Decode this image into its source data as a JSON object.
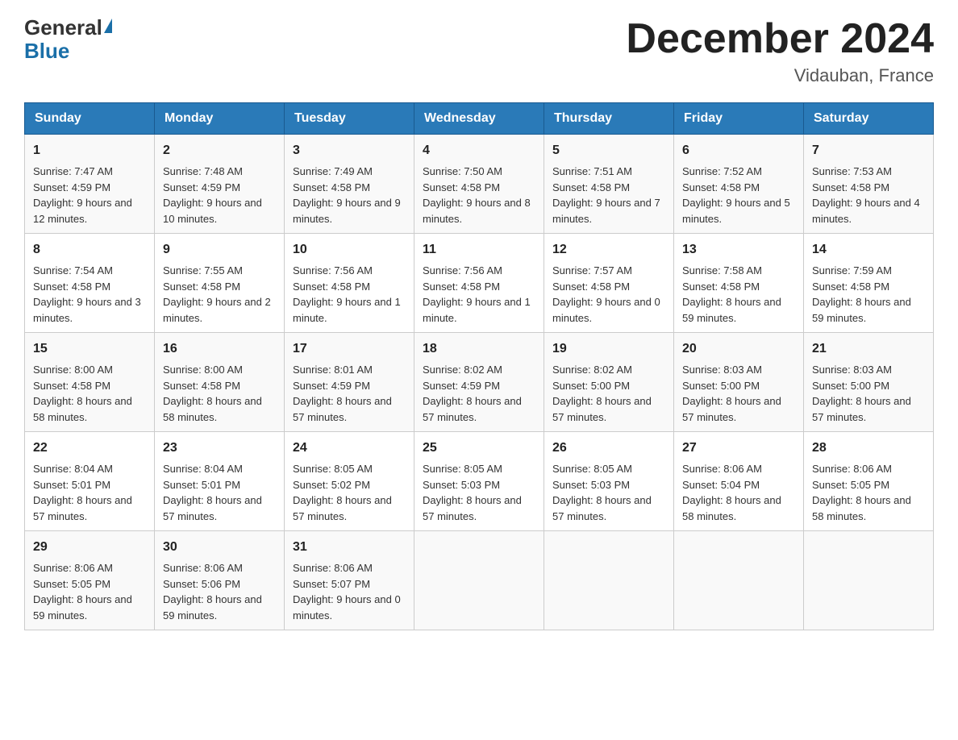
{
  "logo": {
    "general": "General",
    "blue": "Blue"
  },
  "title": "December 2024",
  "subtitle": "Vidauban, France",
  "days_header": [
    "Sunday",
    "Monday",
    "Tuesday",
    "Wednesday",
    "Thursday",
    "Friday",
    "Saturday"
  ],
  "weeks": [
    [
      {
        "day": "1",
        "sunrise": "7:47 AM",
        "sunset": "4:59 PM",
        "daylight": "9 hours and 12 minutes."
      },
      {
        "day": "2",
        "sunrise": "7:48 AM",
        "sunset": "4:59 PM",
        "daylight": "9 hours and 10 minutes."
      },
      {
        "day": "3",
        "sunrise": "7:49 AM",
        "sunset": "4:58 PM",
        "daylight": "9 hours and 9 minutes."
      },
      {
        "day": "4",
        "sunrise": "7:50 AM",
        "sunset": "4:58 PM",
        "daylight": "9 hours and 8 minutes."
      },
      {
        "day": "5",
        "sunrise": "7:51 AM",
        "sunset": "4:58 PM",
        "daylight": "9 hours and 7 minutes."
      },
      {
        "day": "6",
        "sunrise": "7:52 AM",
        "sunset": "4:58 PM",
        "daylight": "9 hours and 5 minutes."
      },
      {
        "day": "7",
        "sunrise": "7:53 AM",
        "sunset": "4:58 PM",
        "daylight": "9 hours and 4 minutes."
      }
    ],
    [
      {
        "day": "8",
        "sunrise": "7:54 AM",
        "sunset": "4:58 PM",
        "daylight": "9 hours and 3 minutes."
      },
      {
        "day": "9",
        "sunrise": "7:55 AM",
        "sunset": "4:58 PM",
        "daylight": "9 hours and 2 minutes."
      },
      {
        "day": "10",
        "sunrise": "7:56 AM",
        "sunset": "4:58 PM",
        "daylight": "9 hours and 1 minute."
      },
      {
        "day": "11",
        "sunrise": "7:56 AM",
        "sunset": "4:58 PM",
        "daylight": "9 hours and 1 minute."
      },
      {
        "day": "12",
        "sunrise": "7:57 AM",
        "sunset": "4:58 PM",
        "daylight": "9 hours and 0 minutes."
      },
      {
        "day": "13",
        "sunrise": "7:58 AM",
        "sunset": "4:58 PM",
        "daylight": "8 hours and 59 minutes."
      },
      {
        "day": "14",
        "sunrise": "7:59 AM",
        "sunset": "4:58 PM",
        "daylight": "8 hours and 59 minutes."
      }
    ],
    [
      {
        "day": "15",
        "sunrise": "8:00 AM",
        "sunset": "4:58 PM",
        "daylight": "8 hours and 58 minutes."
      },
      {
        "day": "16",
        "sunrise": "8:00 AM",
        "sunset": "4:58 PM",
        "daylight": "8 hours and 58 minutes."
      },
      {
        "day": "17",
        "sunrise": "8:01 AM",
        "sunset": "4:59 PM",
        "daylight": "8 hours and 57 minutes."
      },
      {
        "day": "18",
        "sunrise": "8:02 AM",
        "sunset": "4:59 PM",
        "daylight": "8 hours and 57 minutes."
      },
      {
        "day": "19",
        "sunrise": "8:02 AM",
        "sunset": "5:00 PM",
        "daylight": "8 hours and 57 minutes."
      },
      {
        "day": "20",
        "sunrise": "8:03 AM",
        "sunset": "5:00 PM",
        "daylight": "8 hours and 57 minutes."
      },
      {
        "day": "21",
        "sunrise": "8:03 AM",
        "sunset": "5:00 PM",
        "daylight": "8 hours and 57 minutes."
      }
    ],
    [
      {
        "day": "22",
        "sunrise": "8:04 AM",
        "sunset": "5:01 PM",
        "daylight": "8 hours and 57 minutes."
      },
      {
        "day": "23",
        "sunrise": "8:04 AM",
        "sunset": "5:01 PM",
        "daylight": "8 hours and 57 minutes."
      },
      {
        "day": "24",
        "sunrise": "8:05 AM",
        "sunset": "5:02 PM",
        "daylight": "8 hours and 57 minutes."
      },
      {
        "day": "25",
        "sunrise": "8:05 AM",
        "sunset": "5:03 PM",
        "daylight": "8 hours and 57 minutes."
      },
      {
        "day": "26",
        "sunrise": "8:05 AM",
        "sunset": "5:03 PM",
        "daylight": "8 hours and 57 minutes."
      },
      {
        "day": "27",
        "sunrise": "8:06 AM",
        "sunset": "5:04 PM",
        "daylight": "8 hours and 58 minutes."
      },
      {
        "day": "28",
        "sunrise": "8:06 AM",
        "sunset": "5:05 PM",
        "daylight": "8 hours and 58 minutes."
      }
    ],
    [
      {
        "day": "29",
        "sunrise": "8:06 AM",
        "sunset": "5:05 PM",
        "daylight": "8 hours and 59 minutes."
      },
      {
        "day": "30",
        "sunrise": "8:06 AM",
        "sunset": "5:06 PM",
        "daylight": "8 hours and 59 minutes."
      },
      {
        "day": "31",
        "sunrise": "8:06 AM",
        "sunset": "5:07 PM",
        "daylight": "9 hours and 0 minutes."
      },
      null,
      null,
      null,
      null
    ]
  ],
  "labels": {
    "sunrise": "Sunrise: ",
    "sunset": "Sunset: ",
    "daylight": "Daylight: "
  }
}
